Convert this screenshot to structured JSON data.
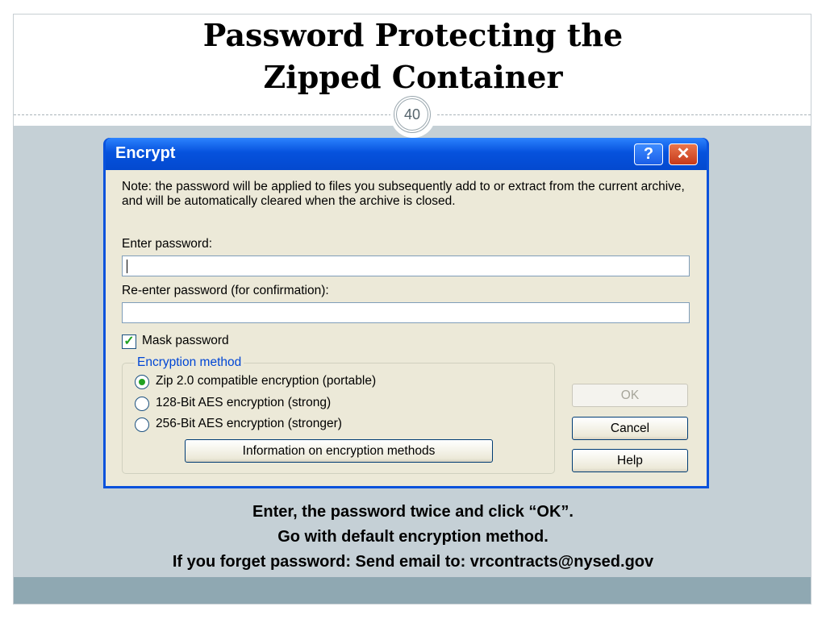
{
  "slide": {
    "title_line1": "Password Protecting the",
    "title_line2": "Zipped Container",
    "page_number": "40",
    "caption_lines": [
      "Enter, the password twice and click “OK”.",
      "Go with default encryption method.",
      "If you forget password: Send email to: vrcontracts@nysed.gov"
    ]
  },
  "dialog": {
    "title": "Encrypt",
    "help_button": "?",
    "close_button": "✕",
    "note": "Note: the password will be applied to files you subsequently add to or extract from the current archive, and will be automatically cleared when the archive is closed.",
    "enter_password_label": "Enter password:",
    "enter_password_value": "",
    "reenter_password_label": "Re-enter password (for confirmation):",
    "reenter_password_value": "",
    "mask_password_label": "Mask password",
    "mask_password_checked": true,
    "encryption_group_label": "Encryption method",
    "encryption_options": [
      {
        "label": "Zip 2.0 compatible encryption (portable)",
        "selected": true
      },
      {
        "label": "128-Bit AES encryption (strong)",
        "selected": false
      },
      {
        "label": "256-Bit AES encryption (stronger)",
        "selected": false
      }
    ],
    "info_button": "Information on encryption methods",
    "ok_button": "OK",
    "cancel_button": "Cancel",
    "help_text_button": "Help"
  },
  "colors": {
    "titlebar": "#0652dd",
    "dialog_bg": "#ece9d8",
    "band": "#c5d0d6",
    "bottom_band": "#8fa8b2"
  }
}
